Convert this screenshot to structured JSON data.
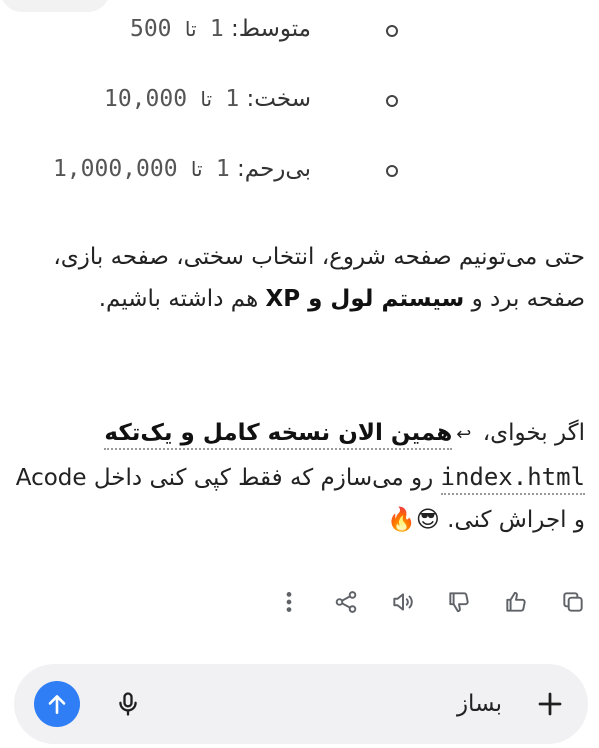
{
  "difficulty_levels": [
    {
      "name": "متوسط",
      "from": "1",
      "to_word": "تا",
      "to": "500"
    },
    {
      "name": "سخت",
      "from": "1",
      "to_word": "تا",
      "to": "10,000"
    },
    {
      "name": "بی‌رحم",
      "from": "1",
      "to_word": "تا",
      "to": "1,000,000"
    }
  ],
  "paragraph1": {
    "text_a": "حتی می‌تونیم صفحه شروع، انتخاب سختی، صفحه بازی، صفحه برد و ",
    "bold": "سیستم لول و XP",
    "text_b": " هم داشته باشیم."
  },
  "paragraph2": {
    "text_a": "اگر بخوای، ",
    "arrow": "↩",
    "bold": "همین الان نسخه کامل و یک‌تکه",
    "code": "index.html",
    "text_b": " رو می‌سازم که فقط کپی کنی داخل Acode و اجراش کنی. ",
    "emoji": "😎🔥"
  },
  "actions": {
    "icons": [
      "more-icon",
      "share-icon",
      "speaker-icon",
      "thumbs-down-icon",
      "thumbs-up-icon",
      "copy-icon"
    ]
  },
  "composer": {
    "input_value": "بساز",
    "send_icon": "arrow-up-icon",
    "mic_icon": "mic-icon",
    "plus_icon": "plus-icon",
    "accent_color": "#2f7ef6"
  }
}
